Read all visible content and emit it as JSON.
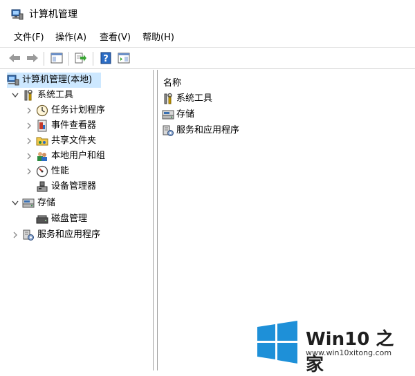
{
  "window": {
    "title": "计算机管理"
  },
  "menu": [
    {
      "label": "文件(F)"
    },
    {
      "label": "操作(A)"
    },
    {
      "label": "查看(V)"
    },
    {
      "label": "帮助(H)"
    }
  ],
  "toolbar": {
    "buttons": [
      {
        "name": "back-button",
        "icon": "arrow-left-icon"
      },
      {
        "name": "forward-button",
        "icon": "arrow-right-icon"
      },
      {
        "name": "show-hide-tree-button",
        "icon": "console-tree-icon"
      },
      {
        "name": "export-list-button",
        "icon": "export-icon"
      },
      {
        "name": "help-button",
        "icon": "help-icon"
      },
      {
        "name": "show-hide-action-pane-button",
        "icon": "action-pane-icon"
      }
    ]
  },
  "tree": {
    "root": "计算机管理(本地)",
    "items": [
      {
        "label": "系统工具",
        "icon": "tools-icon",
        "expanded": true
      },
      {
        "label": "任务计划程序",
        "icon": "clock-icon"
      },
      {
        "label": "事件查看器",
        "icon": "event-viewer-icon"
      },
      {
        "label": "共享文件夹",
        "icon": "shared-folder-icon"
      },
      {
        "label": "本地用户和组",
        "icon": "users-icon"
      },
      {
        "label": "性能",
        "icon": "performance-icon"
      },
      {
        "label": "设备管理器",
        "icon": "device-manager-icon"
      },
      {
        "label": "存储",
        "icon": "storage-icon",
        "expanded": true
      },
      {
        "label": "磁盘管理",
        "icon": "disk-icon"
      },
      {
        "label": "服务和应用程序",
        "icon": "services-icon"
      }
    ]
  },
  "list": {
    "column": "名称",
    "items": [
      {
        "label": "系统工具",
        "icon": "tools-icon"
      },
      {
        "label": "存储",
        "icon": "storage-icon"
      },
      {
        "label": "服务和应用程序",
        "icon": "services-icon"
      }
    ]
  },
  "watermark": {
    "title": "Win10 之家",
    "url": "www.win10xitong.com",
    "color": "#1e90d8"
  },
  "colors": {
    "selection": "#cde8ff",
    "help_blue": "#2b6cc4"
  }
}
